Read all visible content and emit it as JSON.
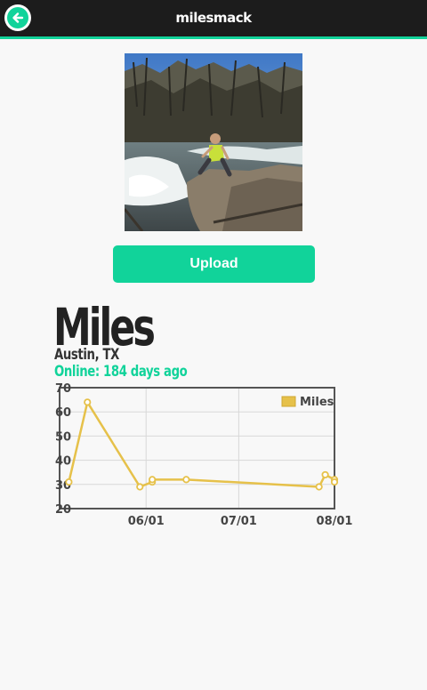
{
  "topbar": {
    "title": "milesmack",
    "back_icon": "arrow-left-circle-icon"
  },
  "upload": {
    "label": "Upload"
  },
  "profile": {
    "name": "Miles",
    "location": "Austin, TX",
    "online_status": "Online: 184 days ago"
  },
  "colors": {
    "accent": "#11d39a",
    "topbar": "#1c1c1c",
    "series": "#e6c14a"
  },
  "chart_data": {
    "type": "line",
    "title": "",
    "xlabel": "",
    "ylabel": "",
    "ylim": [
      20,
      70
    ],
    "yticks": [
      "70",
      "60",
      "50",
      "40",
      "30",
      "20"
    ],
    "xticks": [
      "06/01",
      "07/01",
      "08/01"
    ],
    "legend": {
      "position": "top-right",
      "entries": [
        "Miles"
      ]
    },
    "grid": true,
    "series": [
      {
        "name": "Miles",
        "points": [
          {
            "x": "2015-05-07",
            "y": 31
          },
          {
            "x": "2015-05-13",
            "y": 64
          },
          {
            "x": "2015-05-30",
            "y": 29
          },
          {
            "x": "2015-06-03",
            "y": 31
          },
          {
            "x": "2015-06-03",
            "y": 32
          },
          {
            "x": "2015-06-14",
            "y": 32
          },
          {
            "x": "2015-07-27",
            "y": 29
          },
          {
            "x": "2015-07-29",
            "y": 34
          },
          {
            "x": "2015-08-01",
            "y": 32
          },
          {
            "x": "2015-08-01",
            "y": 31
          }
        ]
      }
    ]
  }
}
